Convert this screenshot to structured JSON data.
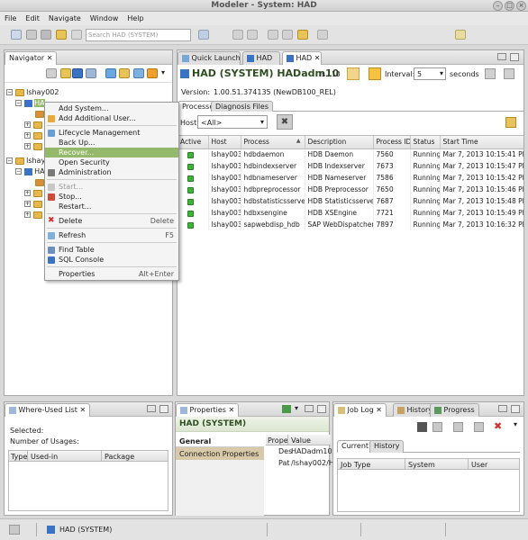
{
  "window": {
    "title": "Modeler - System: HAD",
    "min": "–",
    "max": "□",
    "close": "×"
  },
  "menubar": [
    "File",
    "Edit",
    "Navigate",
    "Window",
    "Help"
  ],
  "toolbar": {
    "search_placeholder": "Search HAD (SYSTEM)"
  },
  "navigator": {
    "tab_label": "Navigator",
    "items": [
      {
        "label": "lshay002"
      },
      {
        "label": "lshay0"
      },
      {
        "label": "HA"
      }
    ]
  },
  "context_menu": {
    "items": [
      {
        "label": "Add System...",
        "shortcut": ""
      },
      {
        "label": "Add Additional User...",
        "shortcut": ""
      },
      {
        "label": "Lifecycle Management",
        "shortcut": ""
      },
      {
        "label": "Back Up...",
        "shortcut": ""
      },
      {
        "label": "Recover...",
        "shortcut": ""
      },
      {
        "label": "Open Security",
        "shortcut": ""
      },
      {
        "label": "Administration",
        "shortcut": ""
      },
      {
        "label": "Start...",
        "shortcut": ""
      },
      {
        "label": "Stop...",
        "shortcut": ""
      },
      {
        "label": "Restart...",
        "shortcut": ""
      },
      {
        "label": "Delete",
        "shortcut": "Delete"
      },
      {
        "label": "Refresh",
        "shortcut": "F5"
      },
      {
        "label": "Find Table",
        "shortcut": ""
      },
      {
        "label": "SQL Console",
        "shortcut": ""
      },
      {
        "label": "Properties",
        "shortcut": "Alt+Enter"
      }
    ]
  },
  "editor": {
    "tabs": [
      {
        "label": "Quick Launch"
      },
      {
        "label": "HAD"
      },
      {
        "label": "HAD"
      }
    ],
    "header_title": "HAD (SYSTEM) HADadm10",
    "header_host": "ls...10",
    "interval_label": "Interval:",
    "interval_value": "5",
    "interval_unit": "seconds",
    "version_label": "Version:",
    "version_value": "1.00.51.374135 (NewDB100_REL)",
    "subtabs": [
      {
        "label": "Processes"
      },
      {
        "label": "Diagnosis Files"
      }
    ],
    "host_label": "Host:",
    "host_value": "<All>",
    "columns": [
      "Active",
      "Host",
      "Process",
      "Description",
      "Process ID",
      "Status",
      "Start Time"
    ],
    "rows": [
      {
        "host": "lshay003",
        "process": "hdbdaemon",
        "description": "HDB Daemon",
        "pid": "7560",
        "status": "Running",
        "start": "Mar 7, 2013 10:15:41 PM"
      },
      {
        "host": "lshay003",
        "process": "hdbindexserver",
        "description": "HDB Indexserver",
        "pid": "7673",
        "status": "Running",
        "start": "Mar 7, 2013 10:15:47 PM"
      },
      {
        "host": "lshay003",
        "process": "hdbnameserver",
        "description": "HDB Nameserver",
        "pid": "7586",
        "status": "Running",
        "start": "Mar 7, 2013 10:15:42 PM"
      },
      {
        "host": "lshay003",
        "process": "hdbpreprocessor",
        "description": "HDB Preprocessor",
        "pid": "7650",
        "status": "Running",
        "start": "Mar 7, 2013 10:15:46 PM"
      },
      {
        "host": "lshay003",
        "process": "hdbstatisticsserver",
        "description": "HDB Statisticsserver",
        "pid": "7687",
        "status": "Running",
        "start": "Mar 7, 2013 10:15:48 PM"
      },
      {
        "host": "lshay003",
        "process": "hdbxsengine",
        "description": "HDB XSEngine",
        "pid": "7721",
        "status": "Running",
        "start": "Mar 7, 2013 10:15:49 PM"
      },
      {
        "host": "lshay003",
        "process": "sapwebdisp_hdb",
        "description": "SAP WebDispatcher",
        "pid": "7897",
        "status": "Running",
        "start": "Mar 7, 2013 10:16:32 PM"
      }
    ]
  },
  "where_used": {
    "tab_label": "Where-Used List",
    "selected_label": "Selected:",
    "usages_label": "Number of Usages:",
    "columns": [
      "Type",
      "Used-in",
      "Package"
    ]
  },
  "properties": {
    "tab_label": "Properties",
    "title": "HAD (SYSTEM)",
    "sections": [
      "General",
      "Connection Properties"
    ],
    "columns": [
      "Prope",
      "Value"
    ],
    "rows": [
      {
        "prop": "Des",
        "value": "HADadm10"
      },
      {
        "prop": "Pat",
        "value": "/lshay002/H"
      }
    ]
  },
  "joblog": {
    "tabs": [
      {
        "label": "Job Log"
      },
      {
        "label": "History"
      },
      {
        "label": "Progress"
      }
    ],
    "subtabs": [
      {
        "label": "Current"
      },
      {
        "label": "History"
      }
    ],
    "columns": [
      "Job Type",
      "System",
      "User"
    ]
  },
  "statusbar": {
    "text": "HAD (SYSTEM)"
  },
  "colors": {
    "accent_green": "#95b96a",
    "led_green": "#3fb23a",
    "folder": "#e8b84a"
  }
}
